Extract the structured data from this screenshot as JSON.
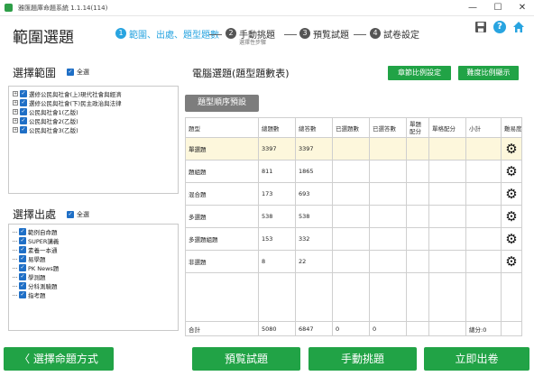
{
  "window": {
    "title": "雅匯題庫命題系統 1.1.14(114)",
    "controls": {
      "minimize": "—",
      "maximize": "☐",
      "close": "✕"
    }
  },
  "header": {
    "title": "範圍選題",
    "steps": [
      {
        "num": "1",
        "label": "範圍、出處、題型題數",
        "sub": ""
      },
      {
        "num": "2",
        "label": "手動挑題",
        "sub": "選擇性步驟"
      },
      {
        "num": "3",
        "label": "預覧試題",
        "sub": ""
      },
      {
        "num": "4",
        "label": "試卷設定",
        "sub": ""
      }
    ],
    "icons": {
      "save": "save-icon",
      "help": "?",
      "home": "home-icon"
    }
  },
  "scope": {
    "title": "選擇範圍",
    "select_all": "全選",
    "items": [
      "選修公民與社會(上)現代社會與經濟",
      "選修公民與社會(下)民主政治與法律",
      "公民與社會1(乙版)",
      "公民與社會2(乙版)",
      "公民與社會3(乙版)"
    ]
  },
  "source": {
    "title": "選擇出處",
    "select_all": "全選",
    "items": [
      "範例自命題",
      "SUPER講義",
      "素養一本通",
      "易學題",
      "PK News題",
      "學測題",
      "分科測驗題",
      "指考題"
    ]
  },
  "computer_select": {
    "title": "電腦選題(題型題數表)",
    "chapter_ratio_button": "章節比例設定",
    "difficulty_ratio_button": "難度比例顯示",
    "order_button": "題型順序預設",
    "columns": [
      "題型",
      "總題數",
      "總答數",
      "已選題數",
      "已選答數",
      "單題配分",
      "單格配分",
      "小計",
      "難易度"
    ],
    "rows": [
      {
        "type": "單選題",
        "total_q": "3397",
        "total_a": "3397"
      },
      {
        "type": "題組題",
        "total_q": "811",
        "total_a": "1865"
      },
      {
        "type": "混合題",
        "total_q": "173",
        "total_a": "693"
      },
      {
        "type": "多選題",
        "total_q": "538",
        "total_a": "538"
      },
      {
        "type": "多選題組題",
        "total_q": "153",
        "total_a": "332"
      },
      {
        "type": "非選題",
        "total_q": "8",
        "total_a": "22"
      }
    ],
    "totals": {
      "label": "合計",
      "total_q": "5080",
      "total_a": "6847",
      "sel_q": "0",
      "sel_a": "0",
      "score": "總分:0"
    }
  },
  "footer": {
    "back_button": "〈 選擇命題方式",
    "preview_button": "預覧試題",
    "manual_button": "手動挑題",
    "publish_button": "立即出卷"
  },
  "colors": {
    "accent": "#21a346",
    "step_active": "#28a4e0",
    "selected_row": "#fdf7dc"
  }
}
